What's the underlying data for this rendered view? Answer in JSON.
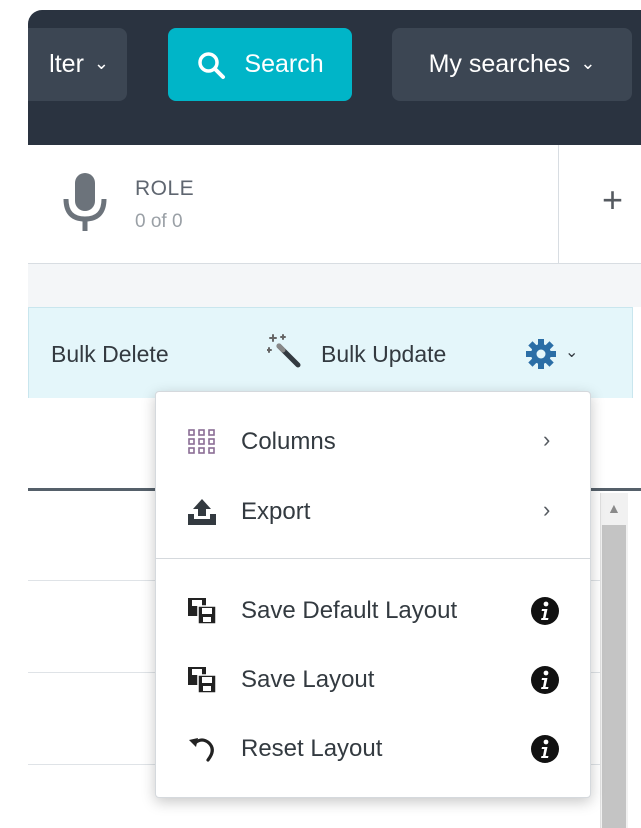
{
  "toolbar": {
    "filter_label": "lter",
    "search_label": "Search",
    "my_searches_label": "My searches"
  },
  "role": {
    "label": "ROLE",
    "count": "0 of 0",
    "add_label": "+"
  },
  "bulk": {
    "delete_label": "Bulk Delete",
    "update_label": "Bulk Update"
  },
  "menu": {
    "columns_label": "Columns",
    "export_label": "Export",
    "save_default_label": "Save Default Layout",
    "save_layout_label": "Save Layout",
    "reset_layout_label": "Reset Layout"
  },
  "colors": {
    "toolbar_bg": "#2a3340",
    "search_accent": "#00b5c8",
    "bulkbar_bg": "#e4f6fa"
  }
}
